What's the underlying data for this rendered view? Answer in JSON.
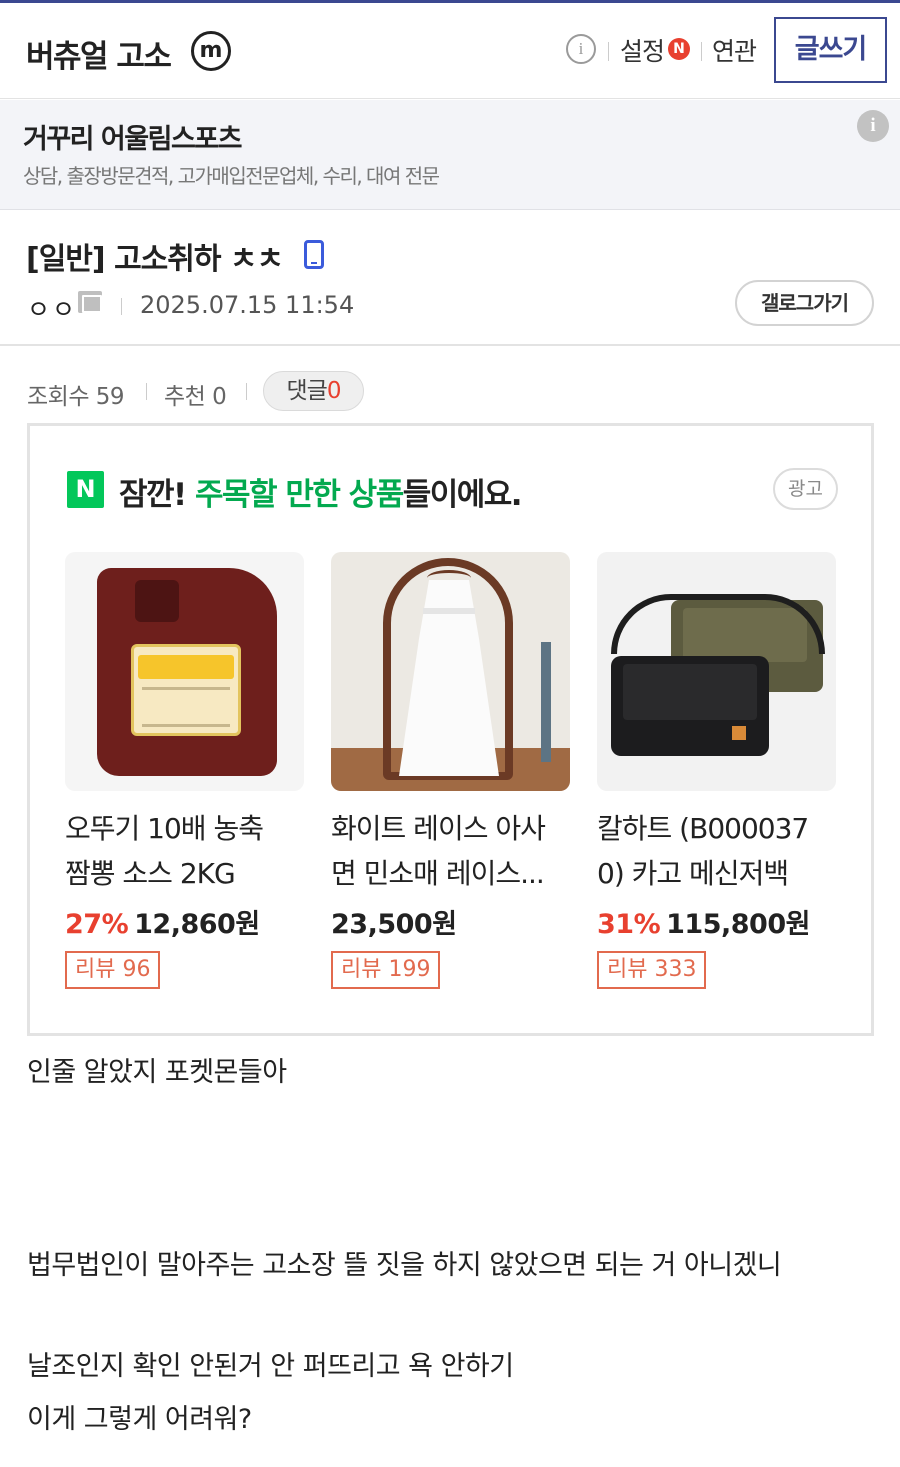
{
  "header": {
    "gallery_name": "버츄얼 고소",
    "gallery_badge": "m",
    "settings_label": "설정",
    "new_badge": "N",
    "related_label": "연관",
    "write_label": "글쓰기"
  },
  "gallery_ad": {
    "title": "거꾸리 어울림스포츠",
    "subtitle": "상담, 출장방문견적, 고가매입전문업체, 수리, 대여 전문"
  },
  "post": {
    "title": "[일반] 고소취하 ㅊㅊ",
    "author": "ㅇㅇ",
    "date": "2025.07.15 11:54",
    "gallery_button": "갤로그가기",
    "views_label": "조회수 59",
    "likes_label": "추천 0",
    "comments_label": "댓글",
    "comments_count": "0"
  },
  "product_ad": {
    "logo": "N",
    "headline_pre": "잠깐! ",
    "headline_highlight": "주목할 만한 상품",
    "headline_post": "들이에요.",
    "ad_label": "광고",
    "products": [
      {
        "name_line1": "오뚜기 10배 농축",
        "name_line2": "짬뽕 소스 2KG",
        "discount": "27%",
        "price": "12,860원",
        "review": "리뷰 96"
      },
      {
        "name_line1": "화이트 레이스 아사",
        "name_line2": "면 민소매 레이스...",
        "discount": "",
        "price": "23,500원",
        "review": "리뷰 199"
      },
      {
        "name_line1": "칼하트 (B000037",
        "name_line2": "0) 카고 메신저백",
        "discount": "31%",
        "price": "115,800원",
        "review": "리뷰 333"
      }
    ]
  },
  "body": {
    "line1": "인줄 알았지 포켓몬들아",
    "line2": "법무법인이 말아주는 고소장 뜰 짓을 하지 않았으면 되는 거 아니겠니",
    "line3": "날조인지 확인 안된거 안 퍼뜨리고 욕 안하기",
    "line4": "이게 그렇게 어려워?"
  },
  "colors": {
    "brand": "#3b4890",
    "accent_red": "#e8402f",
    "naver_green": "#03c75a"
  },
  "icons": [
    "m-icon",
    "info-icon",
    "new-badge",
    "ad-info-icon",
    "mobile-icon",
    "fixed-nick-icon",
    "naver-logo"
  ]
}
